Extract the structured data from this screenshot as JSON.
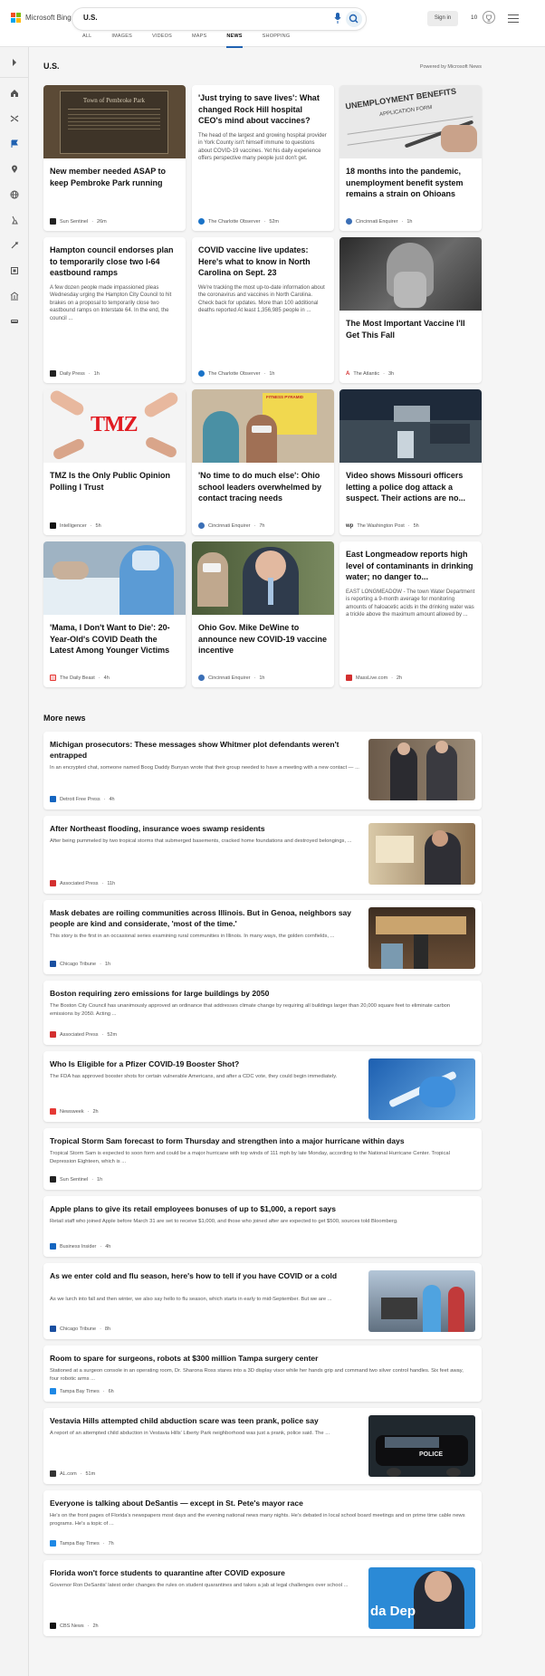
{
  "header": {
    "brand": "Microsoft Bing",
    "query": "U.S.",
    "sign_in": "Sign in",
    "rewards": "10",
    "tabs": [
      {
        "label": "ALL"
      },
      {
        "label": "IMAGES"
      },
      {
        "label": "VIDEOS"
      },
      {
        "label": "MAPS"
      },
      {
        "label": "NEWS"
      },
      {
        "label": "SHOPPING"
      }
    ],
    "active_tab": "NEWS"
  },
  "rail": {
    "icons": [
      "expand-icon",
      "home-icon",
      "shuffle-icon",
      "flag-icon",
      "location-icon",
      "globe-icon",
      "science-icon",
      "sports-icon",
      "movies-icon",
      "money-icon",
      "car-icon"
    ]
  },
  "page": {
    "title": "U.S.",
    "powered_by": "Powered by Microsoft News"
  },
  "cards": [
    {
      "title": "New member needed ASAP to keep Pembroke Park running",
      "snippet": "",
      "source": "Sun Sentinel",
      "age": "26m",
      "fav_color": "#222222",
      "img": "plaque"
    },
    {
      "title": "'Just trying to save lives': What changed Rock Hill hospital CEO's mind about vaccines?",
      "snippet": "The head of the largest and growing hospital provider in York County isn't himself immune to questions about COVID-19 vaccines. Yet his daily experience offers perspective many people just don't get.",
      "source": "The Charlotte Observer",
      "age": "52m",
      "fav_color": "#1a73c8",
      "img": ""
    },
    {
      "title": "18 months into the pandemic, unemployment benefit system remains a strain on Ohioans",
      "snippet": "",
      "source": "Cincinnati Enquirer",
      "age": "1h",
      "fav_color": "#3b6fb6",
      "img": "form"
    },
    {
      "title": "Hampton council endorses plan to temporarily close two I-64 eastbound ramps",
      "snippet": "A few dozen people made impassioned pleas Wednesday urging the Hampton City Council to hit brakes on a proposal to temporarily close two eastbound ramps on Interstate 64. In the end, the council ...",
      "source": "Daily Press",
      "age": "1h",
      "fav_color": "#222222",
      "img": ""
    },
    {
      "title": "COVID vaccine live updates: Here's what to know in North Carolina on Sept. 23",
      "snippet": "We're tracking the most up-to-date information about the coronavirus and vaccines in North Carolina. Check back for updates. More than 100 additional deaths reported At least 1,356,985 people in ...",
      "source": "The Charlotte Observer",
      "age": "1h",
      "fav_color": "#1a73c8",
      "img": ""
    },
    {
      "title": "The Most Important Vaccine I'll Get This Fall",
      "snippet": "",
      "source": "The Atlantic",
      "age": "3h",
      "fav_color": "#d32f2f",
      "img": "bw"
    },
    {
      "title": "TMZ Is the Only Public Opinion Polling I Trust",
      "snippet": "",
      "source": "Intelligencer",
      "age": "5h",
      "fav_color": "#111111",
      "img": "tmz"
    },
    {
      "title": "'No time to do much else': Ohio school leaders overwhelmed by contact tracing needs",
      "snippet": "",
      "source": "Cincinnati Enquirer",
      "age": "7h",
      "fav_color": "#3b6fb6",
      "img": "school"
    },
    {
      "title": "Video shows Missouri officers letting a police dog attack a suspect. Their actions are no...",
      "snippet": "",
      "source": "The Washington Post",
      "age": "5h",
      "fav_color": "#333333",
      "img": "dash"
    },
    {
      "title": "'Mama, I Don't Want to Die': 20-Year-Old's COVID Death the Latest Among Younger Victims",
      "snippet": "",
      "source": "The Daily Beast",
      "age": "4h",
      "fav_color": "#e53935",
      "img": "hospital"
    },
    {
      "title": "Ohio Gov. Mike DeWine to announce new COVID-19 vaccine incentive",
      "snippet": "",
      "source": "Cincinnati Enquirer",
      "age": "1h",
      "fav_color": "#3b6fb6",
      "img": "governor"
    },
    {
      "title": "East Longmeadow reports high level of contaminants in drinking water; no danger to...",
      "snippet": "EAST LONGMEADOW - The town Water Department is reporting a 9-month average for monitoring amounts of haloacetic acids in the drinking water was a trickle above the maximum amount allowed by ...",
      "source": "MassLive.com",
      "age": "2h",
      "fav_color": "#d32f2f",
      "img": ""
    }
  ],
  "more_news": {
    "heading": "More news",
    "items": [
      {
        "title": "Michigan prosecutors: These messages show Whitmer plot defendants weren't entrapped",
        "desc": "In an encrypted chat, someone named Boog Daddy Bunyan wrote that their group needed to have a meeting with a new contact — ...",
        "source": "Detroit Free Press",
        "age": "4h",
        "fav_color": "#1565c0",
        "img": "suits"
      },
      {
        "title": "After Northeast flooding, insurance woes swamp residents",
        "desc": "After being pummeled by two tropical storms that submerged basements, cracked home foundations and destroyed belongings, ...",
        "source": "Associated Press",
        "age": "11h",
        "fav_color": "#d32f2f",
        "img": "flood"
      },
      {
        "title": "Mask debates are roiling communities across Illinois. But in Genoa, neighbors say people are kind and considerate, 'most of the time.'",
        "desc": "This story is the first in an occasional series examining rural communities in Illinois. In many ways, the golden cornfields, ...",
        "source": "Chicago Tribune",
        "age": "1h",
        "fav_color": "#1a4fa0",
        "img": "store"
      },
      {
        "title": "Boston requiring zero emissions for large buildings by 2050",
        "desc": "The Boston City Council has unanimously approved an ordinance that addresses climate change by requiring all buildings larger than 20,000 square feet to eliminate carbon emissions by 2050. Acting ...",
        "source": "Associated Press",
        "age": "52m",
        "fav_color": "#d32f2f",
        "img": ""
      },
      {
        "title": "Who Is Eligible for a Pfizer COVID-19 Booster Shot?",
        "desc": "The FDA has approved booster shots for certain vulnerable Americans, and after a CDC vote, they could begin immediately.",
        "source": "Newsweek",
        "age": "2h",
        "fav_color": "#e53935",
        "img": "syringe"
      },
      {
        "title": "Tropical Storm Sam forecast to form Thursday and strengthen into a major hurricane within days",
        "desc": "Tropical Storm Sam is expected to soon form and could be a major hurricane with top winds of 111 mph by late Monday, according to the National Hurricane Center. Tropical Depression Eighteen, which is ...",
        "source": "Sun Sentinel",
        "age": "1h",
        "fav_color": "#222222",
        "img": ""
      },
      {
        "title": "Apple plans to give its retail employees bonuses of up to $1,000, a report says",
        "desc": "Retail staff who joined Apple before March 31 are set to receive $1,000, and those who joined after are expected to get $500, sources told Bloomberg.",
        "source": "Business Insider",
        "age": "4h",
        "fav_color": "#1565c0",
        "img": ""
      },
      {
        "title": "As we enter cold and flu season, here's how to tell if you have COVID or a cold",
        "desc": "As we lurch into fall and then winter, we also say hello to flu season, which starts in early to mid-September. But we are ...",
        "source": "Chicago Tribune",
        "age": "8h",
        "fav_color": "#1a4fa0",
        "img": "testing"
      },
      {
        "title": "Room to spare for surgeons, robots at $300 million Tampa surgery center",
        "desc": "Stationed at a surgeon console in an operating room, Dr. Sharona Ross stares into a 3D display visor while her hands grip and command two silver control handles. Six feet away, four robotic arms ...",
        "source": "Tampa Bay Times",
        "age": "6h",
        "fav_color": "#1e88e5",
        "img": ""
      },
      {
        "title": "Vestavia Hills attempted child abduction scare was teen prank, police say",
        "desc": "A report of an attempted child abduction in Vestavia Hills' Liberty Park neighborhood was just a prank, police said. The ...",
        "source": "AL.com",
        "age": "51m",
        "fav_color": "#333333",
        "img": "police"
      },
      {
        "title": "Everyone is talking about DeSantis — except in St. Pete's mayor race",
        "desc": "He's on the front pages of Florida's newspapers most days and the evening national news many nights. He's debated in local school board meetings and on prime time cable news programs. He's a topic of ...",
        "source": "Tampa Bay Times",
        "age": "7h",
        "fav_color": "#1e88e5",
        "img": ""
      },
      {
        "title": "Florida won't force students to quarantine after COVID exposure",
        "desc": "Governor Ron DeSantis' latest order changes the rules on student quarantines and takes a jab at legal challenges over school ...",
        "source": "CBS News",
        "age": "2h",
        "fav_color": "#111111",
        "img": "desantis",
        "img_text": "da Dep"
      }
    ]
  },
  "image_text": {
    "plaque": "Town of Pembroke Park",
    "form_title": "UNEMPLOYMENT BENEFITS",
    "form_sub": "APPLICATION FORM",
    "tmz": "TMZ",
    "school_banner": "FITNESS PYRAMID",
    "police": "POLICE"
  }
}
